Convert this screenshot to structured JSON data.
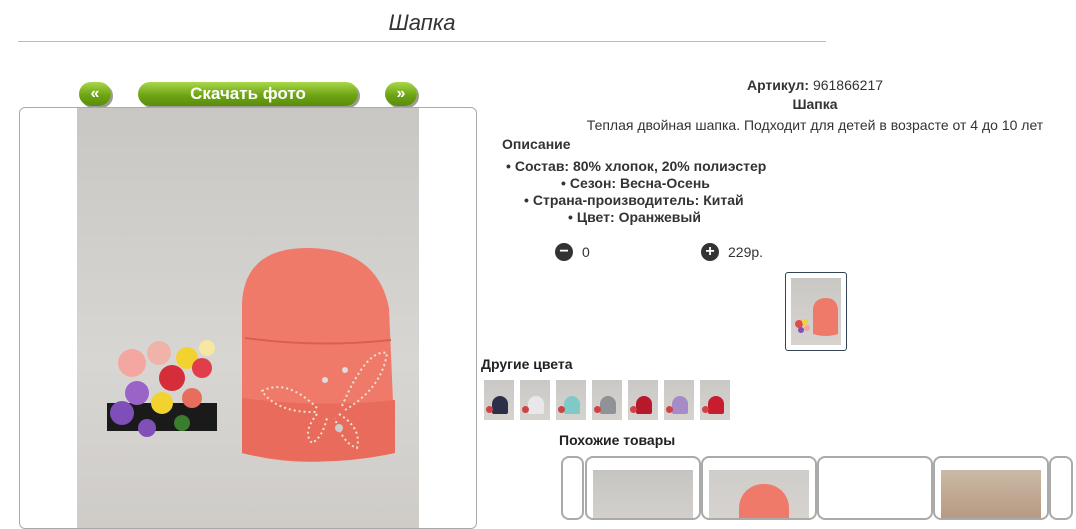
{
  "page": {
    "title": "Шапка"
  },
  "gallery": {
    "prev_label": "«",
    "download_label": "Скачать фото",
    "next_label": "»"
  },
  "product": {
    "article_label": "Артикул:",
    "article_value": "961866217",
    "name": "Шапка",
    "description": "Теплая двойная шапка. Подходит для детей в возрасте от 4 до 10 лет",
    "description_heading": "Описание",
    "specs": [
      "Состав: 80% хлопок, 20% полиэстер",
      "Сезон: Весна-Осень",
      "Страна-производитель: Китай",
      "Цвет: Оранжевый"
    ],
    "quantity": "0",
    "price": "229р.",
    "minus_icon": "minus-circle-icon",
    "plus_icon": "plus-circle-icon"
  },
  "other_colors": {
    "heading": "Другие цвета",
    "items": [
      {
        "color": "#2b2f4a"
      },
      {
        "color": "#e8e8ea"
      },
      {
        "color": "#7fc9c6"
      },
      {
        "color": "#8f9296"
      },
      {
        "color": "#b8182c"
      },
      {
        "color": "#a58cc8"
      },
      {
        "color": "#c81c30"
      }
    ]
  },
  "similar": {
    "heading": "Похожие товары"
  },
  "colors": {
    "accent_green": "#6ea414",
    "hat_coral": "#f07a6a"
  }
}
